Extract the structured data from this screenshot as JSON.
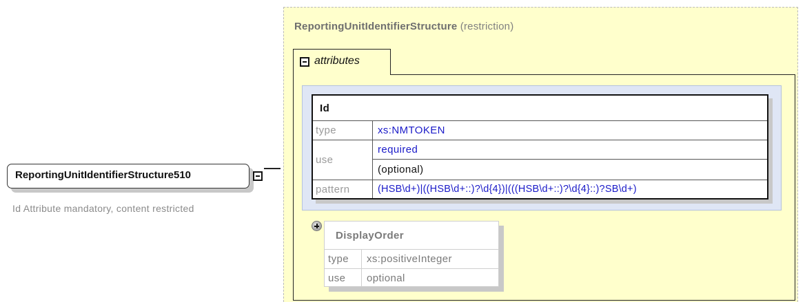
{
  "element": {
    "name": "ReportingUnitIdentifierStructure510",
    "description": "Id Attribute mandatory, content restricted"
  },
  "type_panel": {
    "type_name": "ReportingUnitIdentifierStructure",
    "derivation": "(restriction)",
    "attributes_label": "attributes"
  },
  "attributes": [
    {
      "name": "Id",
      "rows": {
        "type_key": "type",
        "type_value": "xs:NMTOKEN",
        "use_key": "use",
        "use_value": "required",
        "use_note": "(optional)",
        "pattern_key": "pattern",
        "pattern_value": "(HSB\\d+)|((HSB\\d+::)?\\d{4})|(((HSB\\d+::)?\\d{4}::)?SB\\d+)"
      }
    },
    {
      "name": "DisplayOrder",
      "rows": {
        "type_key": "type",
        "type_value": "xs:positiveInteger",
        "use_key": "use",
        "use_value": "optional"
      }
    }
  ],
  "colors": {
    "panel_background": "#ffffcc",
    "group_background": "#dfe6f5",
    "link_blue": "#1a1ac8",
    "inherited_grey": "#7a7a7a"
  },
  "icons": [
    "collapse-icon",
    "expand-icon"
  ]
}
